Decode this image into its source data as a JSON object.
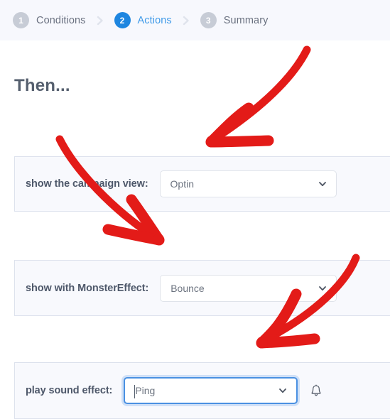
{
  "stepper": {
    "steps": [
      {
        "number": "1",
        "label": "Conditions",
        "active": false
      },
      {
        "number": "2",
        "label": "Actions",
        "active": true
      },
      {
        "number": "3",
        "label": "Summary",
        "active": false
      }
    ],
    "separator_icon": "chevron-right-icon"
  },
  "main": {
    "heading": "Then...",
    "rows": [
      {
        "label": "show the campaign view:",
        "value": "Optin",
        "caret_icon": "chevron-down-icon",
        "focused": false
      },
      {
        "label": "show with MonsterEffect:",
        "value": "Bounce",
        "caret_icon": "chevron-down-icon",
        "focused": false
      },
      {
        "label": "play sound effect:",
        "value": "Ping",
        "caret_icon": "chevron-down-icon",
        "trailing_icon": "bell-icon",
        "focused": true
      }
    ]
  },
  "annotations": {
    "arrow_color": "#e31b18",
    "arrows": [
      {
        "name": "arrow-to-campaign-view-select",
        "points_to": "show the campaign view: Optin"
      },
      {
        "name": "arrow-to-monstereffect-select",
        "points_to": "show with MonsterEffect: Bounce"
      },
      {
        "name": "arrow-to-sound-effect-select",
        "points_to": "play sound effect: Ping"
      }
    ]
  },
  "colors": {
    "header_bg": "#f7f8fd",
    "panel_bg": "#f8f9fd",
    "panel_border": "#dde2ed",
    "active_step": "#1e86e0",
    "inactive_step": "#c7ccd6",
    "heading_text": "#555f6e",
    "focus_blue": "#4a90e2"
  }
}
